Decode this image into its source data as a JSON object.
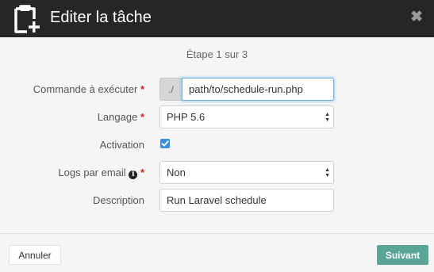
{
  "header": {
    "title": "Editer la tâche",
    "icon": "clipboard-plus-icon",
    "close_icon": "close-icon",
    "close_glyph": "✖"
  },
  "step": "Étape 1 sur 3",
  "form": {
    "command": {
      "label": "Commande à exécuter",
      "required_mark": "*",
      "prefix": "./",
      "value": "path/to/schedule-run.php"
    },
    "language": {
      "label": "Langage",
      "required_mark": "*",
      "value": "PHP 5.6"
    },
    "activation": {
      "label": "Activation",
      "checked": true
    },
    "email_logs": {
      "label": "Logs par email",
      "required_mark": "*",
      "info_icon": "info-icon",
      "value": "Non"
    },
    "description": {
      "label": "Description",
      "value": "Run Laravel schedule"
    }
  },
  "footer": {
    "cancel_label": "Annuler",
    "next_label": "Suivant"
  },
  "colors": {
    "header_bg": "#262626",
    "primary_button": "#5aa598",
    "checkbox": "#3c8fdc",
    "required": "#cc2222"
  }
}
